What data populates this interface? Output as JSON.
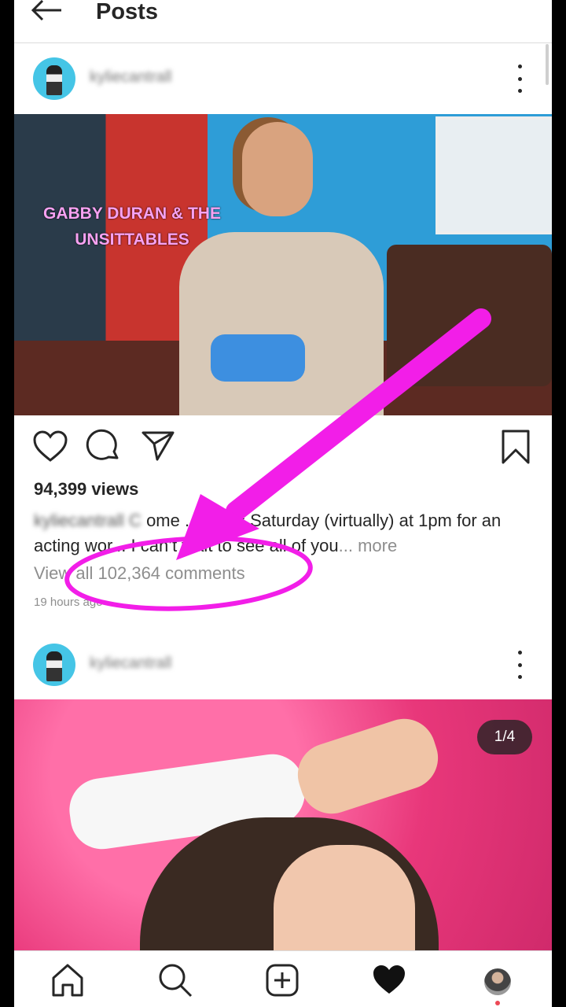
{
  "header": {
    "title": "Posts",
    "back_icon": "arrow-left-icon"
  },
  "posts": [
    {
      "username": "kyliecantrall",
      "image_overlay_text": "GABBY DURAN & THE UNSITTABLES",
      "views": "94,399 views",
      "caption_blurred_prefix": "kyliecantrall C",
      "caption_text": "ome ... e this Saturday (virtually) at 1pm for an acting wor... I can’t wait to see all of you",
      "caption_more": "... more",
      "view_comments": "View all 102,364 comments",
      "timestamp": "19 hours ago"
    },
    {
      "username": "kyliecantrall",
      "carousel_counter": "1/4"
    }
  ],
  "colors": {
    "annotation": "#f21ee8",
    "text": "#262626",
    "muted": "#8e8e8e"
  },
  "bottom_nav": [
    "home-icon",
    "search-icon",
    "new-post-icon",
    "activity-heart-icon",
    "profile-avatar"
  ]
}
